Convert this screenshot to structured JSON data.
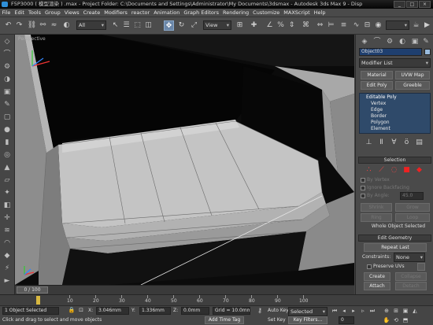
{
  "window": {
    "title": "F5P3000 ( 模型渲染 ) .max  -  Project Folder: C:\\Documents and Settings\\Administrator\\My Documents\\3dsmax  -  Autodesk 3ds Max 9  -  Disp",
    "min": "_",
    "max": "□",
    "close": "×"
  },
  "menu": [
    "File",
    "Edit",
    "Tools",
    "Group",
    "Views",
    "Create",
    "Modifiers",
    "reactor",
    "Animation",
    "Graph Editors",
    "Rendering",
    "Customize",
    "MAXScript",
    "Help"
  ],
  "toolbar": {
    "selection_filter": "All",
    "reference_coord": "View",
    "icons": [
      "undo-icon",
      "redo-icon",
      "link-icon",
      "unlink-icon",
      "bind-icon",
      "select-icon",
      "select-by-name-icon",
      "rect-select-icon",
      "window-cross-icon",
      "move-icon",
      "rotate-icon",
      "scale-icon",
      "pivot-icon",
      "mirror-icon",
      "align-icon",
      "layer-icon",
      "curve-editor-icon",
      "schematic-icon",
      "material-icon",
      "render-scene-icon",
      "quick-render-icon"
    ]
  },
  "viewport": {
    "label": "Perspective"
  },
  "command_panel": {
    "object_name": "Object03",
    "modifier_list": "Modifier List",
    "buttons": [
      "Material",
      "UVW Map",
      "Edit Poly",
      "Greeble"
    ],
    "stack": {
      "root": "Editable Poly",
      "items": [
        "Vertex",
        "Edge",
        "Border",
        "Polygon",
        "Element"
      ]
    },
    "selection": {
      "header": "Selection",
      "by_vertex": "By Vertex",
      "ignore_backfacing": "Ignore Backfacing",
      "by_angle": "By Angle:",
      "angle_value": "45.0",
      "shrink": "Shrink",
      "grow": "Grow",
      "ring": "Ring",
      "loop": "Loop",
      "status": "Whole Object Selected"
    },
    "edit_geometry": {
      "header": "Edit Geometry",
      "repeat_last": "Repeat Last",
      "constraints_label": "Constraints:",
      "constraints_value": "None",
      "preserve_uvs": "Preserve UVs",
      "create": "Create",
      "collapse": "Collapse",
      "attach": "Attach",
      "detach": "Detach",
      "slice_plane": "Slice Plane",
      "split": "Split"
    }
  },
  "timeline": {
    "slider": "0 / 100"
  },
  "ruler": {
    "labels": [
      "10",
      "20",
      "30",
      "40",
      "50",
      "60",
      "70",
      "80",
      "90",
      "100"
    ]
  },
  "status": {
    "objects": "1 Object Selected",
    "prompt": "Click and drag to select and move objects",
    "x_label": "X:",
    "x_value": "3.046mm",
    "y_label": "Y:",
    "y_value": "1.336mm",
    "z_label": "Z:",
    "z_value": "0.0mm",
    "grid": "Grid = 10.0mm",
    "auto_key": "Auto Key",
    "selected": "Selected",
    "set_key": "Set Key",
    "key_filters": "Key Filters...",
    "add_time_tag": "Add Time Tag",
    "frame": "0"
  },
  "colors": {
    "viewport_bg": "#0b0b0b",
    "mesh_light": "#c6c6c6",
    "mesh_dark": "#8a8a8a",
    "active_button": "#6a86a8",
    "stack_bg": "#2f4a6a"
  }
}
